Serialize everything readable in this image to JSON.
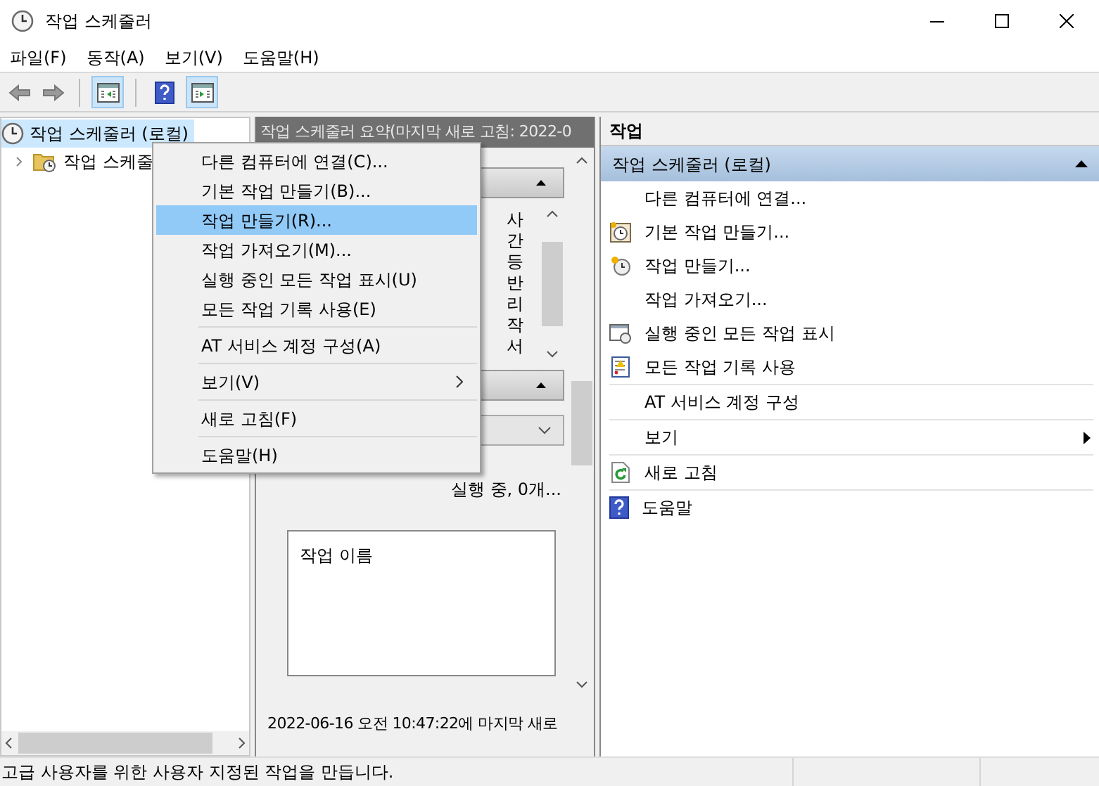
{
  "window": {
    "title": "작업 스케줄러"
  },
  "menu_bar": [
    "파일(F)",
    "동작(A)",
    "보기(V)",
    "도움말(H)"
  ],
  "tree": [
    {
      "label": "작업 스케줄러 (로컬)",
      "selected": true,
      "children": [
        {
          "label": "작업 스케줄",
          "selected": false,
          "expanded": false
        }
      ]
    }
  ],
  "summary": {
    "header": "작업 스케줄러 요약(마지막 새로 고침: 2022-0",
    "fragments": [
      "사",
      "간",
      "등",
      "반",
      "리",
      "작",
      "서"
    ],
    "status_line": "실행 중, 0개...",
    "list_column": "작업 이름",
    "footer": "2022-06-16 오전 10:47:22에 마지막 새로"
  },
  "context_menu": [
    {
      "kind": "item",
      "label": "다른 컴퓨터에 연결(C)...",
      "selected": false
    },
    {
      "kind": "item",
      "label": "기본 작업 만들기(B)...",
      "selected": false
    },
    {
      "kind": "item",
      "label": "작업 만들기(R)...",
      "selected": true
    },
    {
      "kind": "item",
      "label": "작업 가져오기(M)...",
      "selected": false
    },
    {
      "kind": "item",
      "label": "실행 중인 모든 작업 표시(U)",
      "selected": false
    },
    {
      "kind": "item",
      "label": "모든 작업 기록 사용(E)",
      "selected": false
    },
    {
      "kind": "separator"
    },
    {
      "kind": "item",
      "label": "AT 서비스 계정 구성(A)",
      "selected": false
    },
    {
      "kind": "separator"
    },
    {
      "kind": "submenu",
      "label": "보기(V)",
      "selected": false
    },
    {
      "kind": "separator"
    },
    {
      "kind": "item",
      "label": "새로 고침(F)",
      "selected": false
    },
    {
      "kind": "separator"
    },
    {
      "kind": "item",
      "label": "도움말(H)",
      "selected": false
    }
  ],
  "actions": {
    "title": "작업",
    "group": {
      "label": "작업 스케줄러 (로컬)",
      "expanded": true
    },
    "items": [
      {
        "kind": "plain",
        "label": "다른 컴퓨터에 연결..."
      },
      {
        "kind": "basic",
        "label": "기본 작업 만들기..."
      },
      {
        "kind": "task",
        "label": "작업 만들기..."
      },
      {
        "kind": "plain",
        "label": "작업 가져오기..."
      },
      {
        "kind": "running",
        "label": "실행 중인 모든 작업 표시"
      },
      {
        "kind": "history",
        "label": "모든 작업 기록 사용"
      },
      {
        "kind": "separator"
      },
      {
        "kind": "plain",
        "label": "AT 서비스 계정 구성"
      },
      {
        "kind": "separator"
      },
      {
        "kind": "submenu",
        "label": "보기"
      },
      {
        "kind": "separator"
      },
      {
        "kind": "refresh",
        "label": "새로 고침"
      },
      {
        "kind": "separator"
      },
      {
        "kind": "help",
        "label": "도움말"
      }
    ]
  },
  "status_bar": "고급 사용자를 위한 사용자 지정된 작업을 만듭니다."
}
